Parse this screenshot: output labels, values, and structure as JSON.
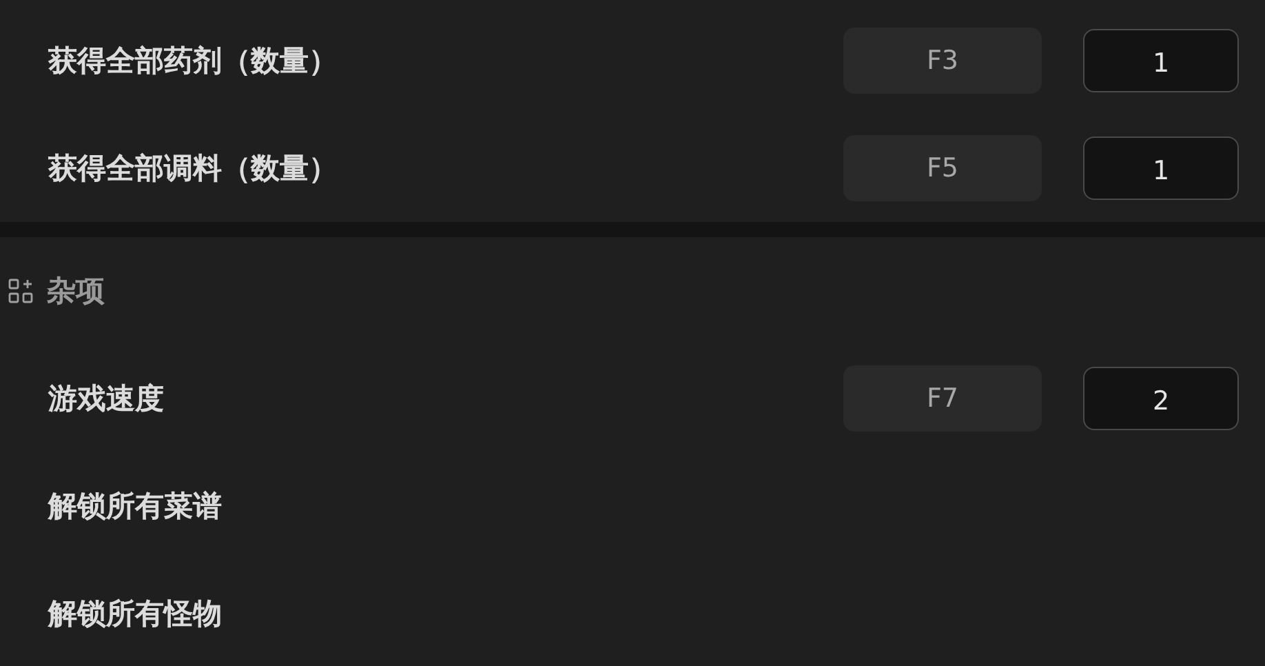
{
  "sections": [
    {
      "rows": [
        {
          "label": "获得全部药剂（数量）",
          "hotkey": "F3",
          "value": "1"
        },
        {
          "label": "获得全部调料（数量）",
          "hotkey": "F5",
          "value": "1"
        }
      ]
    },
    {
      "title": "杂项",
      "rows": [
        {
          "label": "游戏速度",
          "hotkey": "F7",
          "value": "2"
        },
        {
          "label": "解锁所有菜谱"
        },
        {
          "label": "解锁所有怪物"
        }
      ]
    }
  ]
}
